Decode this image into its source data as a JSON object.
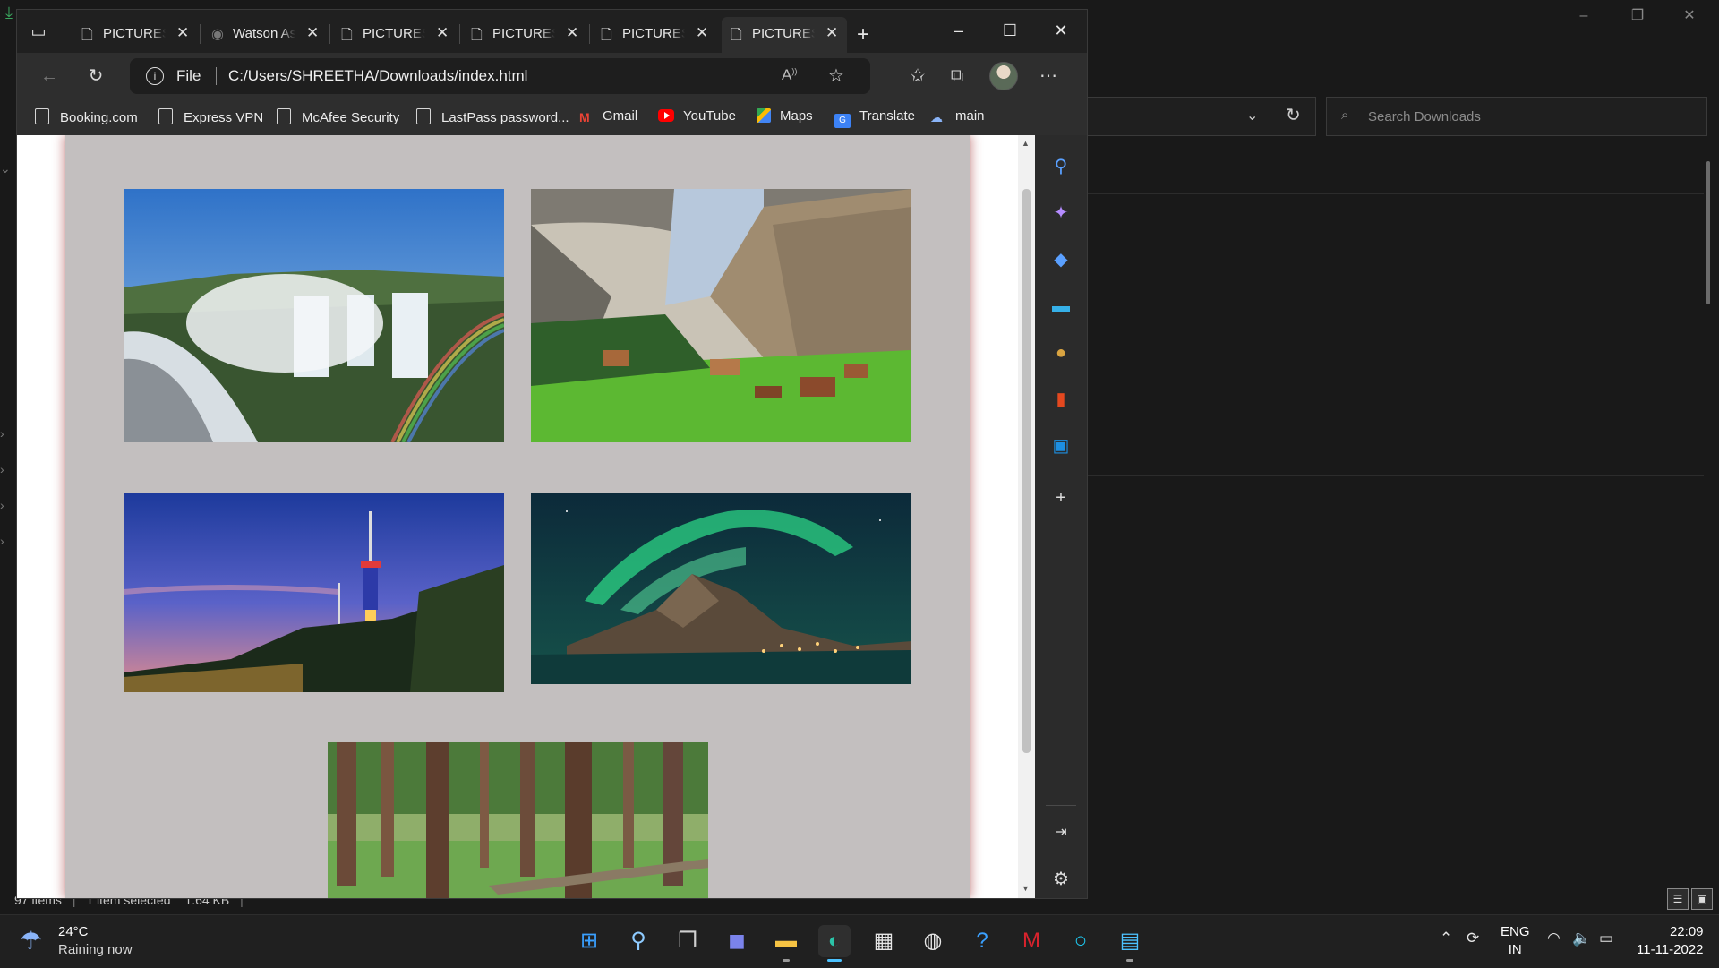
{
  "explorer": {
    "search_placeholder": "Search Downloads",
    "status": {
      "items": "97 items",
      "selected": "1 item selected",
      "size": "1.64 KB"
    }
  },
  "browser": {
    "tabs": [
      {
        "label": "PICTURES",
        "icon": "page-icon"
      },
      {
        "label": "Watson Assistant",
        "icon": "watson-icon"
      },
      {
        "label": "PICTURES",
        "icon": "page-icon"
      },
      {
        "label": "PICTURES",
        "icon": "page-icon"
      },
      {
        "label": "PICTURES",
        "icon": "page-icon"
      },
      {
        "label": "PICTURES",
        "icon": "page-icon",
        "active": true
      }
    ],
    "address": {
      "scheme_label": "File",
      "url": "C:/Users/SHREETHA/Downloads/index.html"
    },
    "bookmarks": [
      {
        "label": "Booking.com",
        "icon": "page-icon"
      },
      {
        "label": "Express VPN",
        "icon": "page-icon"
      },
      {
        "label": "McAfee Security",
        "icon": "page-icon"
      },
      {
        "label": "LastPass password...",
        "icon": "page-icon"
      },
      {
        "label": "Gmail",
        "icon": "gmail-icon"
      },
      {
        "label": "YouTube",
        "icon": "youtube-icon"
      },
      {
        "label": "Maps",
        "icon": "maps-icon"
      },
      {
        "label": "Translate",
        "icon": "translate-icon"
      },
      {
        "label": "main",
        "icon": "weather-cloud-icon"
      }
    ],
    "page": {
      "images": [
        {
          "name": "waterfall-rainbow-photo",
          "subject": "waterfalls with rainbow"
        },
        {
          "name": "alpine-valley-photo",
          "subject": "mountain valley village"
        },
        {
          "name": "city-tower-dusk-photo",
          "subject": "tower over city at dusk"
        },
        {
          "name": "aurora-mountain-photo",
          "subject": "northern lights over mountain"
        },
        {
          "name": "forest-trees-photo",
          "subject": "tall trees in green forest"
        }
      ]
    },
    "sidebar_icons": [
      "search-icon",
      "copilot-icon",
      "shopping-tag-icon",
      "tools-icon",
      "games-icon",
      "office-icon",
      "outlook-icon",
      "add-icon",
      "hide-sidebar-icon",
      "settings-icon"
    ]
  },
  "taskbar": {
    "weather": {
      "temp": "24°C",
      "desc": "Raining now"
    },
    "language": {
      "lang": "ENG",
      "region": "IN"
    },
    "clock": {
      "time": "22:09",
      "date": "11-11-2022"
    }
  },
  "colors": {
    "page_bg": "#c3bfbf",
    "browser_chrome": "#2e2e2e",
    "desktop_bg": "#191919"
  }
}
